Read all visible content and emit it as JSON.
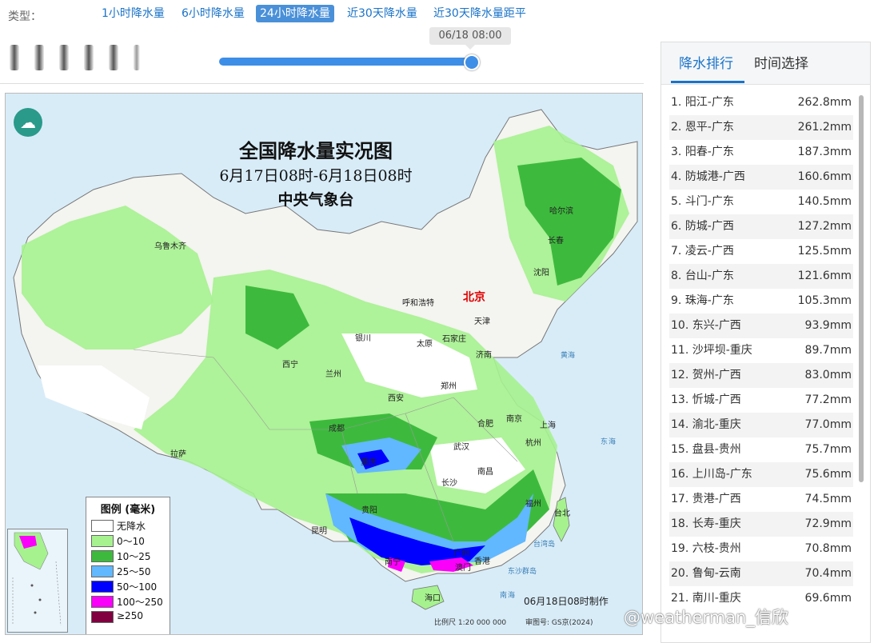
{
  "filter": {
    "label": "类型：",
    "tabs": [
      {
        "label": "1小时降水量",
        "active": false
      },
      {
        "label": "6小时降水量",
        "active": false
      },
      {
        "label": "24小时降水量",
        "active": true
      },
      {
        "label": "近30天降水量",
        "active": false
      },
      {
        "label": "近30天降水量距平",
        "active": false
      }
    ]
  },
  "timeline": {
    "current_time": "06/18 08:00",
    "position_fraction": 1.0
  },
  "map": {
    "title": "全国降水量实况图",
    "period": "6月17日08时-6月18日08时",
    "agency": "中央气象台",
    "capital": "北京",
    "cities": [
      "哈尔滨",
      "长春",
      "沈阳",
      "乌鲁木齐",
      "呼和浩特",
      "天津",
      "银川",
      "太原",
      "石家庄",
      "济南",
      "西宁",
      "兰州",
      "郑州",
      "西安",
      "合肥",
      "南京",
      "上海",
      "成都",
      "重庆",
      "武汉",
      "杭州",
      "拉萨",
      "长沙",
      "南昌",
      "福州",
      "贵阳",
      "台北",
      "昆明",
      "南宁",
      "广州",
      "澳门",
      "香港",
      "海口"
    ],
    "seas": [
      "东",
      "海",
      "台湾岛",
      "东沙群岛",
      "南",
      "海",
      "黄海"
    ],
    "made_time": "06月18日08时制作",
    "scale": "比例尺 1:20 000 000",
    "approval": "审图号: GS京(2024)",
    "legend": {
      "title": "图例 (毫米)",
      "items": [
        {
          "label": "无降水",
          "color": "#ffffff"
        },
        {
          "label": "0～10",
          "color": "#a6f28f"
        },
        {
          "label": "10～25",
          "color": "#3dba3d"
        },
        {
          "label": "25～50",
          "color": "#61b8ff"
        },
        {
          "label": "50～100",
          "color": "#0000ff"
        },
        {
          "label": "100～250",
          "color": "#fa00fa"
        },
        {
          "label": "≥250",
          "color": "#800040"
        }
      ]
    }
  },
  "sidebar": {
    "tabs": [
      {
        "label": "降水排行",
        "active": true
      },
      {
        "label": "时间选择",
        "active": false
      }
    ],
    "ranking": [
      {
        "rank": "1.",
        "name": "阳江-广东",
        "value": "262.8mm"
      },
      {
        "rank": "2.",
        "name": "恩平-广东",
        "value": "261.2mm"
      },
      {
        "rank": "3.",
        "name": "阳春-广东",
        "value": "187.3mm"
      },
      {
        "rank": "4.",
        "name": "防城港-广西",
        "value": "160.6mm"
      },
      {
        "rank": "5.",
        "name": "斗门-广东",
        "value": "140.5mm"
      },
      {
        "rank": "6.",
        "name": "防城-广西",
        "value": "127.2mm"
      },
      {
        "rank": "7.",
        "name": "凌云-广西",
        "value": "125.5mm"
      },
      {
        "rank": "8.",
        "name": "台山-广东",
        "value": "121.6mm"
      },
      {
        "rank": "9.",
        "name": "珠海-广东",
        "value": "105.3mm"
      },
      {
        "rank": "10.",
        "name": "东兴-广西",
        "value": "93.9mm"
      },
      {
        "rank": "11.",
        "name": "沙坪坝-重庆",
        "value": "89.7mm"
      },
      {
        "rank": "12.",
        "name": "贺州-广西",
        "value": "83.0mm"
      },
      {
        "rank": "13.",
        "name": "忻城-广西",
        "value": "77.2mm"
      },
      {
        "rank": "14.",
        "name": "渝北-重庆",
        "value": "77.0mm"
      },
      {
        "rank": "15.",
        "name": "盘县-贵州",
        "value": "75.7mm"
      },
      {
        "rank": "16.",
        "name": "上川岛-广东",
        "value": "75.6mm"
      },
      {
        "rank": "17.",
        "name": "贵港-广西",
        "value": "74.5mm"
      },
      {
        "rank": "18.",
        "name": "长寿-重庆",
        "value": "72.9mm"
      },
      {
        "rank": "19.",
        "name": "六枝-贵州",
        "value": "70.8mm"
      },
      {
        "rank": "20.",
        "name": "鲁甸-云南",
        "value": "70.4mm"
      },
      {
        "rank": "21.",
        "name": "南川-重庆",
        "value": "69.6mm"
      }
    ]
  },
  "watermark": "@weatherman_信欣"
}
